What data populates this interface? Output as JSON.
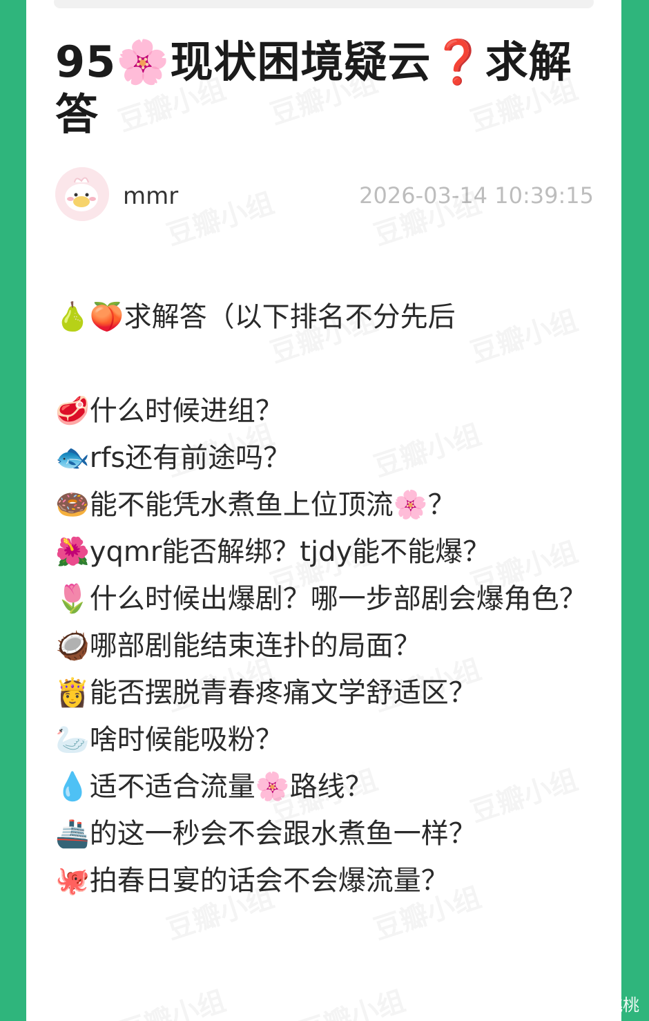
{
  "post": {
    "title": "95🌸现状困境疑云❓求解答",
    "author": "mmr",
    "timestamp": "2026-03-14 10:39:15",
    "intro": "🍐🍑求解答（以下排名不分先后",
    "questions": [
      "🥩什么时候进组？",
      "🐟rfs还有前途吗？",
      "🍩能不能凭水煮鱼上位顶流🌸？",
      "🌺yqmr能否解绑？tjdy能不能爆？",
      "🌷什么时候出爆剧？哪一步部剧会爆角色？",
      "🥥哪部剧能结束连扑的局面？",
      "👸能否摆脱青春疼痛文学舒适区？",
      "🦢啥时候能吸粉？",
      "💧适不适合流量🌸路线？",
      "🚢的这一秒会不会跟水煮鱼一样？",
      "🐙拍春日宴的话会不会爆流量？"
    ]
  },
  "watermark": "豆瓣小组",
  "footer": {
    "weibo_handle": "@一口大屁桃桃"
  },
  "colors": {
    "background": "#2fb57c",
    "card": "#ffffff",
    "timestamp": "#bdbdbd"
  }
}
